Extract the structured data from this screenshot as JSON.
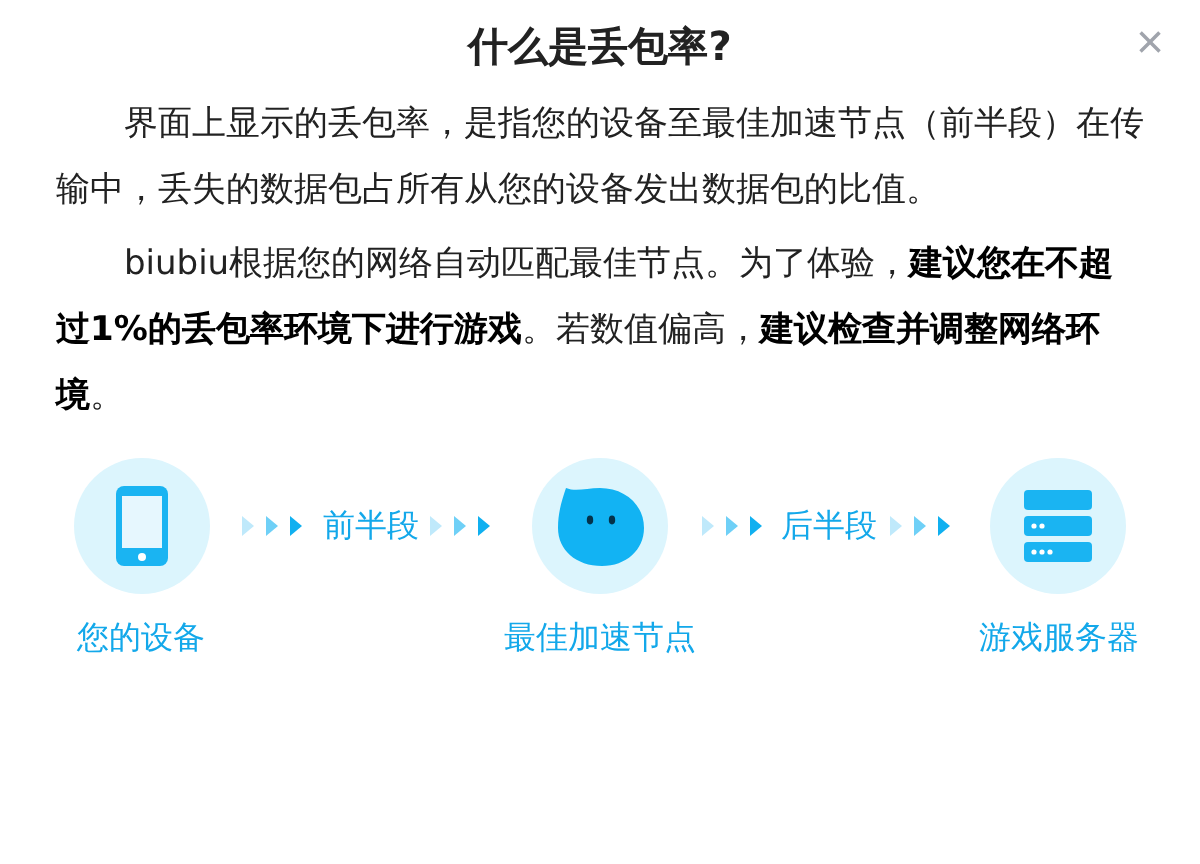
{
  "title": "什么是丢包率?",
  "close": "×",
  "paragraphs": [
    "界面上显示的丢包率，是指您的设备至最佳加速节点（前半段）在传输中，丢失的数据包占所有从您的设备发出数据包的比值。",
    "biubiu根据您的网络自动匹配最佳节点。为了体验，**建议您在不超过1%的丢包率环境下进行游戏**。若数值偏高，**建议检查并调整网络环境**。"
  ],
  "flow": [
    {
      "kind": "device",
      "label": "您的设备"
    },
    {
      "kind": "link",
      "label": "前半段"
    },
    {
      "kind": "node",
      "label": "最佳加速节点"
    },
    {
      "kind": "link",
      "label": "后半段"
    },
    {
      "kind": "server",
      "label": "游戏服务器"
    }
  ]
}
